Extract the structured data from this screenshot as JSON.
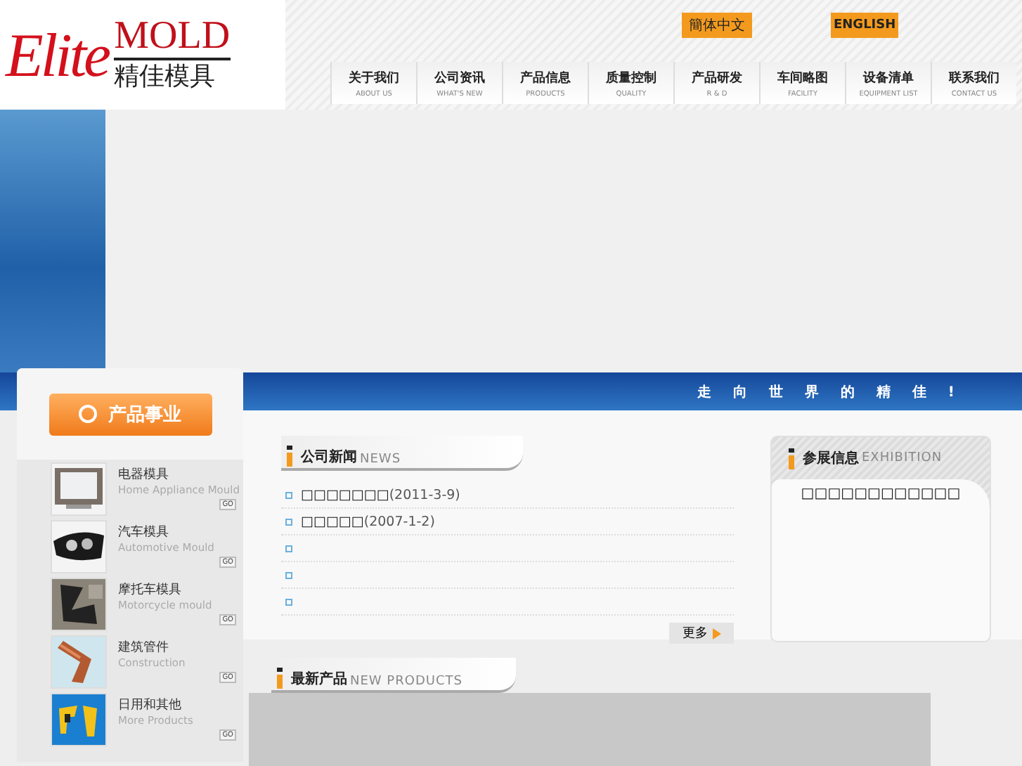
{
  "logo": {
    "script": "Elite",
    "word": "MOLD",
    "chinese": "精佳模具"
  },
  "languages": [
    {
      "label": "簡体中文"
    },
    {
      "label": "ENGLISH"
    }
  ],
  "nav": [
    {
      "label": "关于我们",
      "sub": "ABOUT US"
    },
    {
      "label": "公司资讯",
      "sub": "WHAT'S NEW"
    },
    {
      "label": "产品信息",
      "sub": "PRODUCTS"
    },
    {
      "label": "质量控制",
      "sub": "QUALITY"
    },
    {
      "label": "产品研发",
      "sub": "R & D"
    },
    {
      "label": "车间略图",
      "sub": "FACILITY"
    },
    {
      "label": "设备清单",
      "sub": "EQUIPMENT LIST"
    },
    {
      "label": "联系我们",
      "sub": "CONTACT US"
    }
  ],
  "banner": {
    "slogan": "走 向 世 界 的 精 佳 !"
  },
  "sidebar": {
    "title": "产品事业",
    "items": [
      {
        "name": "电器模具",
        "english": "Home Appliance Mould",
        "go": "GO",
        "kind": "tv"
      },
      {
        "name": "汽车模具",
        "english": "Automotive Mould",
        "go": "GO",
        "kind": "lamp"
      },
      {
        "name": "摩托车模具",
        "english": "Motorcycle mould",
        "go": "GO",
        "kind": "bike"
      },
      {
        "name": "建筑管件",
        "english": "Construction",
        "go": "GO",
        "kind": "pipe"
      },
      {
        "name": "日用和其他",
        "english": "More Products",
        "go": "GO",
        "kind": "other"
      }
    ]
  },
  "news": {
    "title": "公司新闻",
    "subtitle": "NEWS",
    "more": "更多",
    "items": [
      {
        "kind": "link",
        "title": "□□□□□□□",
        "date": "(2011-3-9)"
      },
      {
        "kind": "link",
        "title": "□□□□□",
        "date": "(2007-1-2)"
      },
      {
        "kind": "blank"
      },
      {
        "kind": "blank"
      },
      {
        "kind": "blank"
      }
    ]
  },
  "exhibition": {
    "title": "参展信息",
    "subtitle": "EXHIBITION",
    "text": "□□□□□□□□□□□□"
  },
  "new_products": {
    "title": "最新产品",
    "subtitle": "NEW PRODUCTS"
  }
}
